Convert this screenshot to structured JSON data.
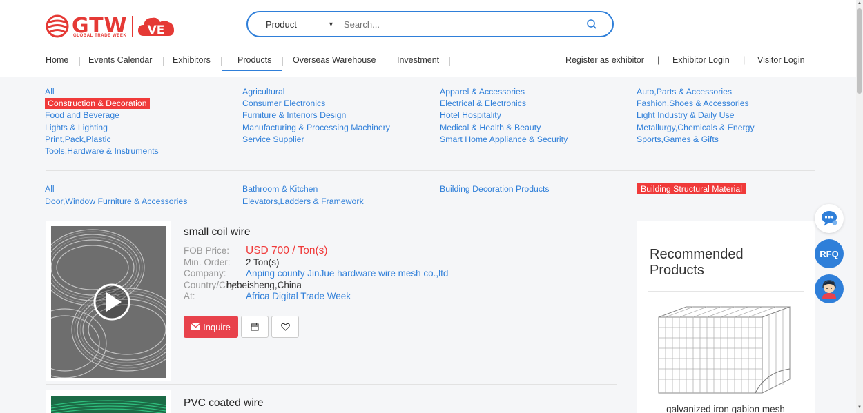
{
  "brand": {
    "name": "GTW",
    "tagline": "GLOBAL TRADE WEEK",
    "badge": "VE",
    "accent": "#e53935",
    "link_color": "#2f7fd9"
  },
  "search": {
    "category": "Product",
    "placeholder": "Search..."
  },
  "nav": {
    "items": [
      "Home",
      "Events Calendar",
      "Exhibitors",
      "Products",
      "Overseas Warehouse",
      "Investment"
    ],
    "active": "Products",
    "right": [
      "Register as exhibitor",
      "Exhibitor Login",
      "Visitor Login"
    ]
  },
  "categories": [
    "All",
    "Agricultural",
    "Apparel & Accessories",
    "Auto,Parts & Accessories",
    "Construction & Decoration",
    "Consumer Electronics",
    "Electrical & Electronics",
    "Fashion,Shoes & Accessories",
    "Food and Beverage",
    "Furniture & Interiors Design",
    "Hotel Hospitality",
    "Light Industry & Daily Use",
    "Lights & Lighting",
    "Manufacturing & Processing Machinery",
    "Medical & Health & Beauty",
    "Metallurgy,Chemicals & Energy",
    "Print,Pack,Plastic",
    "Service Supplier",
    "Smart Home Appliance & Security",
    "Sports,Games & Gifts",
    "Tools,Hardware & Instruments"
  ],
  "selected_category": "Construction & Decoration",
  "subcategories": [
    "All",
    "Bathroom & Kitchen",
    "Building Decoration Products",
    "Building Structural Material",
    "Door,Window Furniture & Accessories",
    "Elevators,Ladders & Framework"
  ],
  "selected_subcategory": "Building Structural Material",
  "products": [
    {
      "name": "small coil wire",
      "fob_label": "FOB Price:",
      "fob": "USD 700 / Ton(s)",
      "min_label": "Min. Order:",
      "min_order": "2 Ton(s)",
      "company_label": "Company:",
      "company": "Anping county JinJue hardware wire mesh co.,ltd",
      "country_label": "Country/City:",
      "country": "hebeisheng,China",
      "at_label": "At:",
      "at": "Africa Digital Trade Week",
      "inquire": "Inquire"
    },
    {
      "name": "PVC coated wire"
    }
  ],
  "recommended": {
    "title": "Recommended Products",
    "item": "galvanized iron gabion mesh"
  },
  "floating": {
    "rfq": "RFQ"
  }
}
